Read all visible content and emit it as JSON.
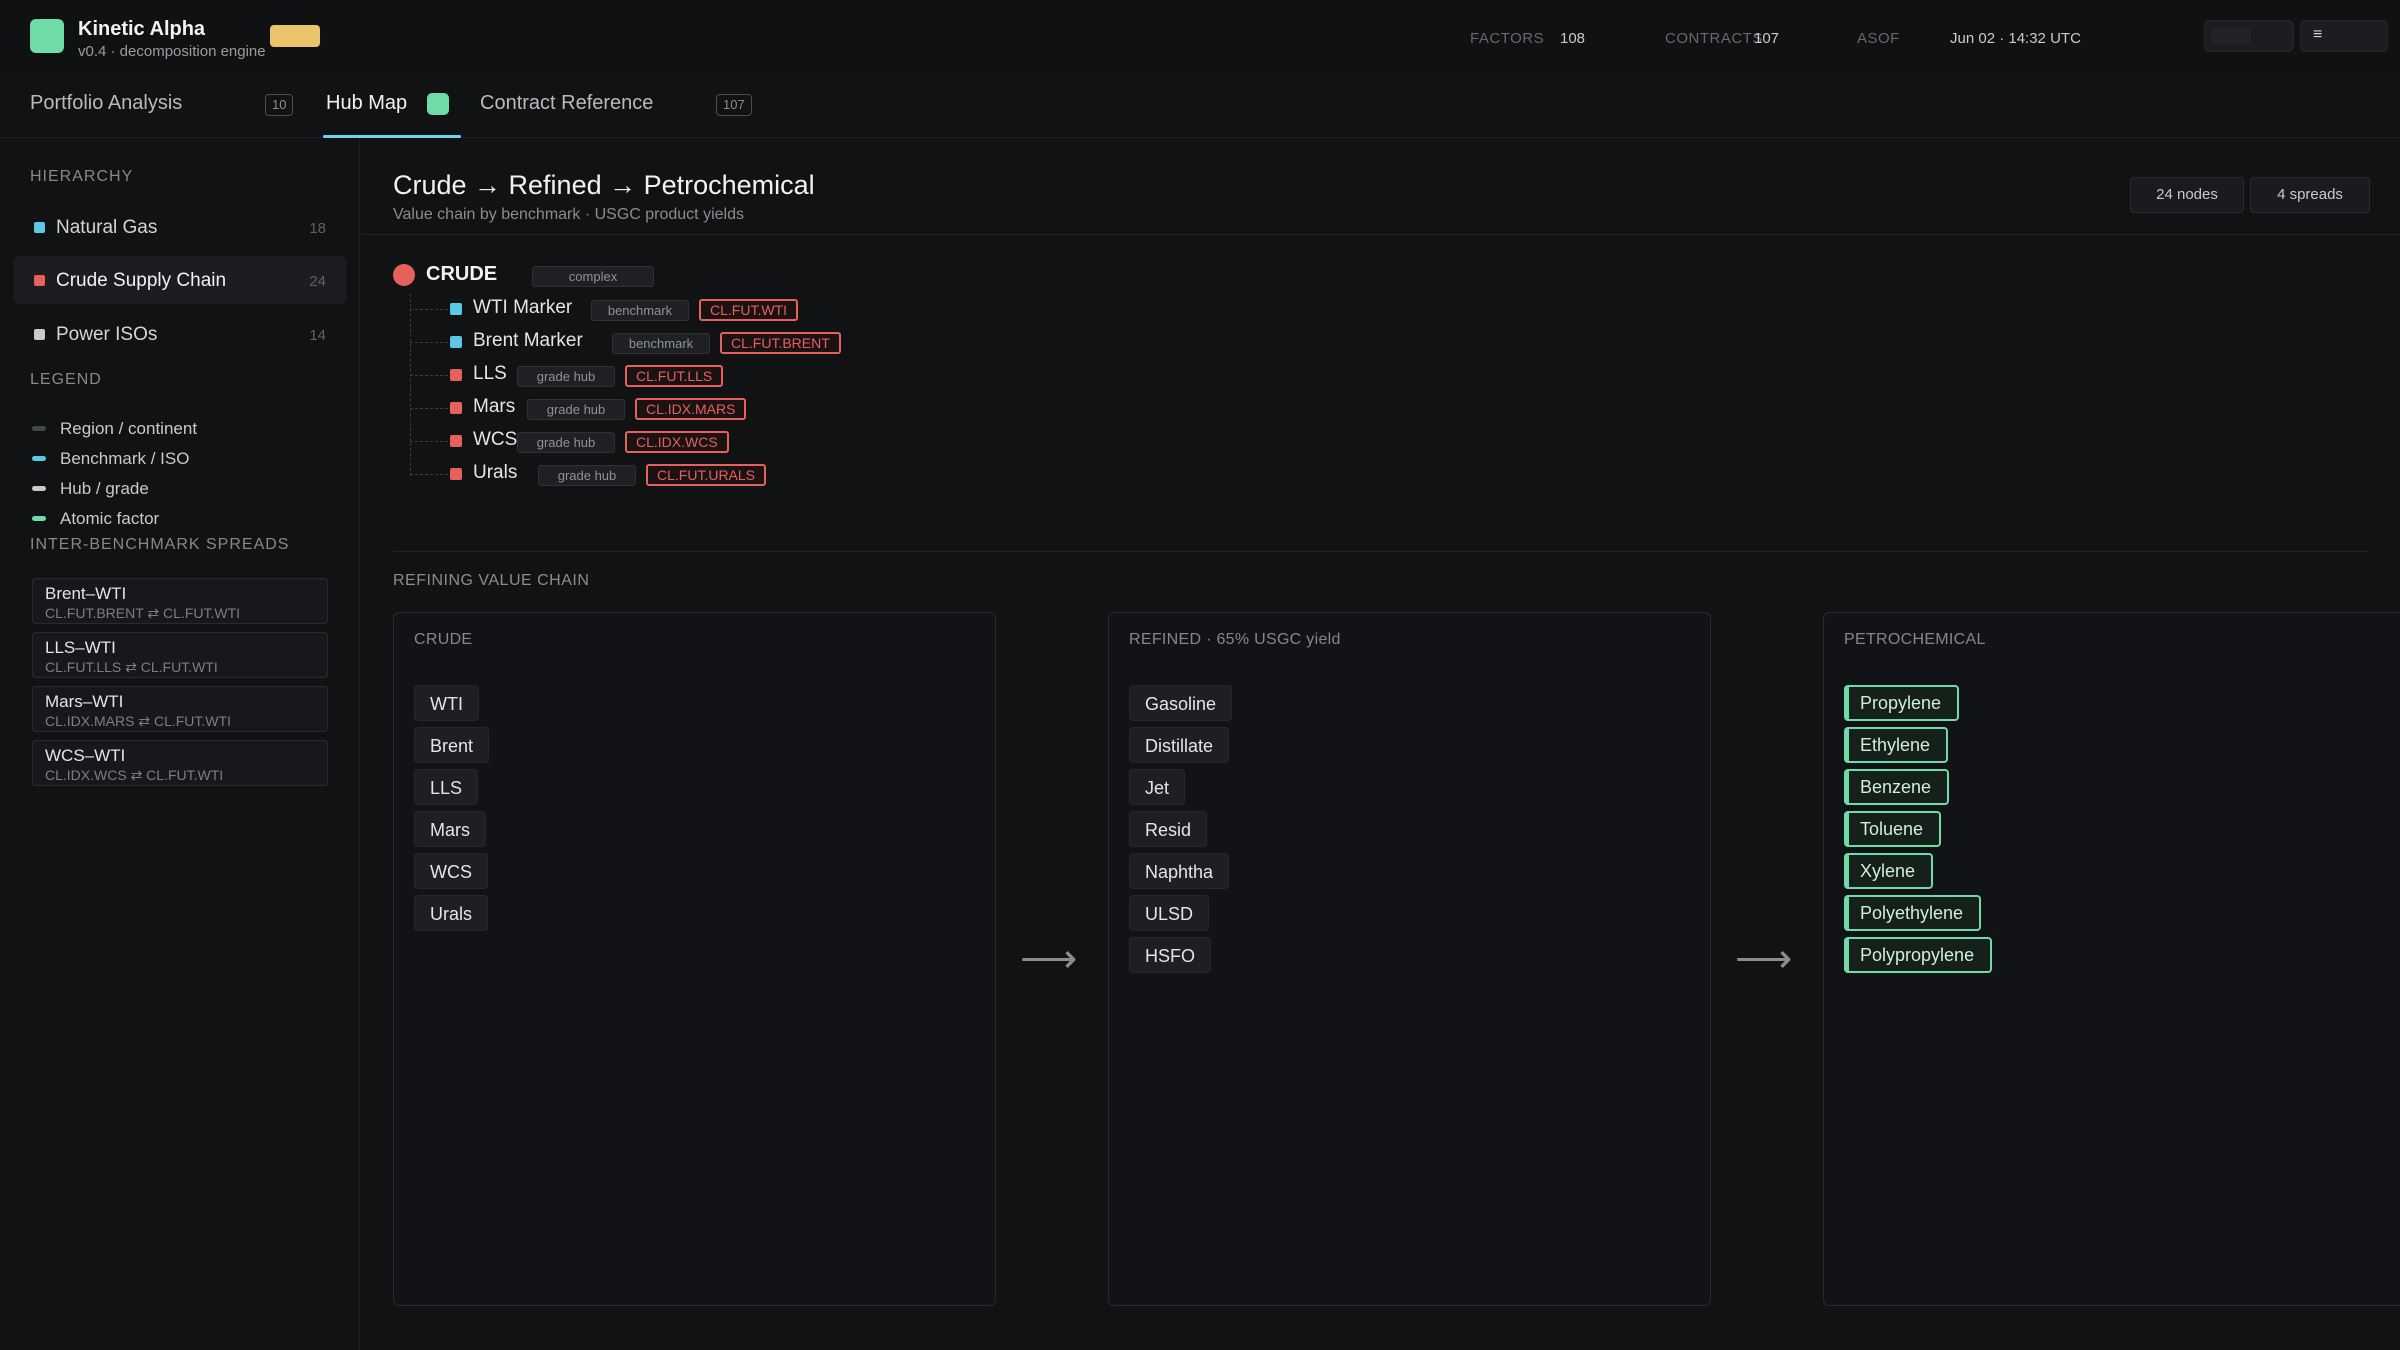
{
  "app": {
    "title": "Kinetic Alpha",
    "subtitle": "v0.4 · decomposition engine",
    "logo_color": "#6fdba6",
    "badge_color": "#e9c46a"
  },
  "stats": [
    {
      "label": "FACTORS",
      "value": "108"
    },
    {
      "label": "CONTRACTS",
      "value": "107"
    },
    {
      "label": "ASOF",
      "value": "Jun 02 · 14:32 UTC"
    }
  ],
  "window_controls": {
    "menu_icon": "≡"
  },
  "tabs": [
    {
      "label": "Portfolio Analysis",
      "count": "10"
    },
    {
      "label": "Hub Map",
      "dot_color": "#6fdba6"
    },
    {
      "label": "Contract Reference",
      "count": "107"
    }
  ],
  "sidebar": {
    "hierarchy_heading": "HIERARCHY",
    "hierarchy": [
      {
        "label": "Natural Gas",
        "count": "18",
        "color": "#5bc8e6"
      },
      {
        "label": "Crude Supply Chain",
        "count": "24",
        "color": "#e6605c"
      },
      {
        "label": "Power ISOs",
        "count": "14",
        "color": "#c9cacd"
      }
    ],
    "legend_heading": "LEGEND",
    "legend": [
      {
        "label": "Region / continent",
        "color": "#3e4a46"
      },
      {
        "label": "Benchmark / ISO",
        "color": "#5bc8e6"
      },
      {
        "label": "Hub / grade",
        "color": "#c9cacd"
      },
      {
        "label": "Atomic factor",
        "color": "#6fdba6"
      }
    ],
    "spreads_heading": "INTER-BENCHMARK SPREADS",
    "spreads": [
      {
        "name": "Brent–WTI",
        "pair": "CL.FUT.BRENT ⇄ CL.FUT.WTI"
      },
      {
        "name": "LLS–WTI",
        "pair": "CL.FUT.LLS ⇄ CL.FUT.WTI"
      },
      {
        "name": "Mars–WTI",
        "pair": "CL.IDX.MARS ⇄ CL.FUT.WTI"
      },
      {
        "name": "WCS–WTI",
        "pair": "CL.IDX.WCS ⇄ CL.FUT.WTI"
      }
    ]
  },
  "main": {
    "title": "Crude → Refined → Petrochemical",
    "subtitle": "Value chain by benchmark · USGC product yields",
    "pills": [
      "24 nodes",
      "4 spreads"
    ],
    "tree": {
      "root": {
        "label": "CRUDE",
        "tag": "complex",
        "color": "#e6605c"
      },
      "children": [
        {
          "label": "WTI Marker",
          "tag": "benchmark",
          "code": "CL.FUT.WTI",
          "color": "#5bc8e6"
        },
        {
          "label": "Brent Marker",
          "tag": "benchmark",
          "code": "CL.FUT.BRENT",
          "color": "#5bc8e6"
        },
        {
          "label": "LLS",
          "tag": "grade hub",
          "code": "CL.FUT.LLS",
          "color": "#e6605c"
        },
        {
          "label": "Mars",
          "tag": "grade hub",
          "code": "CL.IDX.MARS",
          "color": "#e6605c"
        },
        {
          "label": "WCS",
          "tag": "grade hub",
          "code": "CL.IDX.WCS",
          "color": "#e6605c"
        },
        {
          "label": "Urals",
          "tag": "grade hub",
          "code": "CL.FUT.URALS",
          "color": "#e6605c"
        }
      ]
    },
    "value_chain": {
      "heading": "REFINING VALUE CHAIN",
      "arrow": "⟶",
      "columns": [
        {
          "title": "CRUDE",
          "items": [
            "WTI",
            "Brent",
            "LLS",
            "Mars",
            "WCS",
            "Urals"
          ]
        },
        {
          "title": "REFINED · 65% USGC yield",
          "items": [
            "Gasoline",
            "Distillate",
            "Jet",
            "Resid",
            "Naphtha",
            "ULSD",
            "HSFO"
          ]
        },
        {
          "title": "PETROCHEMICAL",
          "items": [
            "Propylene",
            "Ethylene",
            "Benzene",
            "Toluene",
            "Xylene",
            "Polyethylene",
            "Polypropylene"
          ]
        }
      ]
    }
  }
}
